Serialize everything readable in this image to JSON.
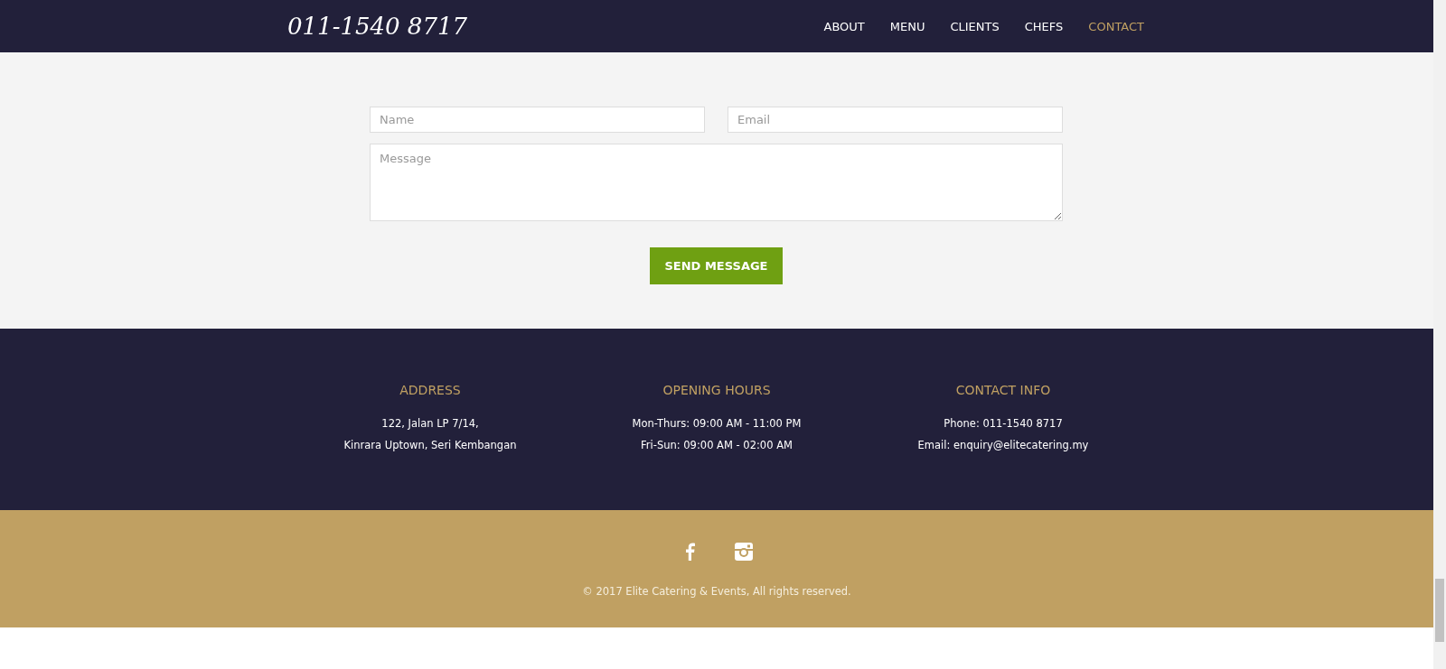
{
  "header": {
    "phone": "011-1540 8717",
    "nav": [
      {
        "label": "ABOUT",
        "selected": false
      },
      {
        "label": "MENU",
        "selected": false
      },
      {
        "label": "CLIENTS",
        "selected": false
      },
      {
        "label": "CHEFS",
        "selected": false
      },
      {
        "label": "CONTACT",
        "selected": true
      }
    ]
  },
  "form": {
    "name": {
      "placeholder": "Name"
    },
    "email": {
      "placeholder": "Email"
    },
    "message": {
      "placeholder": "Message"
    },
    "button": "SEND MESSAGE"
  },
  "info": [
    {
      "title": "ADDRESS",
      "lines": [
        "122, Jalan LP 7/14,",
        "Kinrara Uptown, Seri Kembangan"
      ]
    },
    {
      "title": "OPENING HOURS",
      "lines": [
        "Mon-Thurs: 09:00 AM - 11:00 PM",
        "Fri-Sun: 09:00 AM - 02:00 AM"
      ]
    },
    {
      "title": "CONTACT INFO",
      "lines": [
        "Phone: 011-1540 8717",
        "Email: enquiry@elitecatering.my"
      ]
    }
  ],
  "social": [
    {
      "kind": "facebook"
    },
    {
      "kind": "instagram"
    }
  ],
  "copyright": "© 2017 Elite Catering & Events, All rights reserved."
}
